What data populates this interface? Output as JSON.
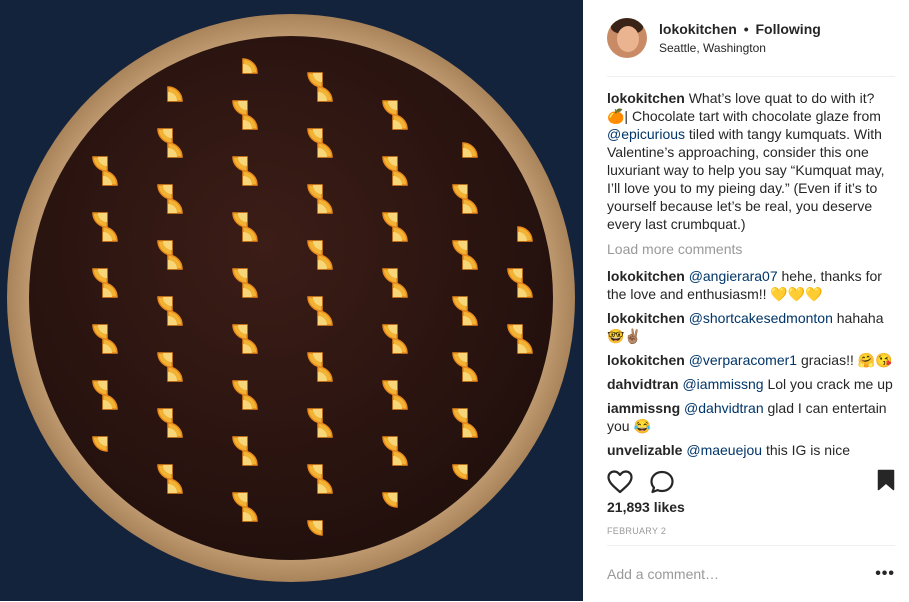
{
  "post": {
    "image_alt": "Chocolate tart tiled with kumquats"
  },
  "header": {
    "username": "lokokitchen",
    "separator": "•",
    "follow_status": "Following",
    "location": "Seattle, Washington"
  },
  "caption": {
    "username": "lokokitchen",
    "text_1": "What’s love quat to do with it? 🍊| Chocolate tart with chocolate glaze from ",
    "mention": "@epicurious",
    "text_2": " tiled with tangy kumquats. With Valentine’s approaching, consider this one luxuriant way to help you say “Kumquat may, I’ll love you to my pieing day.” (Even if it’s to yourself because let’s be real, you deserve every last crumbquat.)"
  },
  "load_more": "Load more comments",
  "comments": [
    {
      "user": "lokokitchen",
      "mention": "@angierara07",
      "text": " hehe, thanks for the love and enthusiasm!! 💛💛💛"
    },
    {
      "user": "lokokitchen",
      "mention": "@shortcakesedmonton",
      "text": " hahaha 🤓✌🏽"
    },
    {
      "user": "lokokitchen",
      "mention": "@verparacomer1",
      "text": " gracias!! 🤗😘"
    },
    {
      "user": "dahvidtran",
      "mention": "@iammissng",
      "text": " Lol you crack me up"
    },
    {
      "user": "iammissng",
      "mention": "@dahvidtran",
      "text": " glad I can entertain you 😂"
    },
    {
      "user": "unvelizable",
      "mention": "@maeuejou",
      "text": " this IG is nice"
    }
  ],
  "actions": {
    "like_icon": "heart-icon",
    "comment_icon": "speech-bubble-icon",
    "save_icon": "bookmark-icon"
  },
  "likes": "21,893 likes",
  "date": "FEBRUARY 2",
  "add_comment": {
    "placeholder": "Add a comment…",
    "more": "•••"
  }
}
